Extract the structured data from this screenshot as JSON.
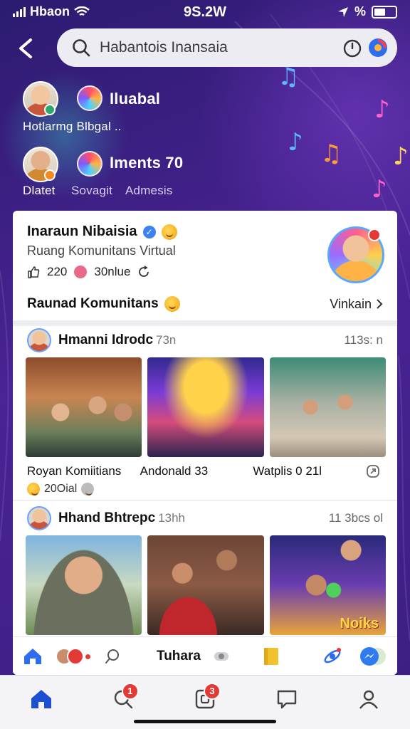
{
  "status_bar": {
    "carrier": "Hbaon",
    "time": "9S.2W",
    "battery_text": "%"
  },
  "search": {
    "value": "Habantois Inansaia"
  },
  "people": [
    {
      "label": "Iluabal"
    },
    {
      "label": "Hotlarmg Blbgal .."
    },
    {
      "label": "Iments 70"
    },
    {
      "label": "Dlatet"
    },
    {
      "label": "Sovagit"
    },
    {
      "label": "Admesis"
    }
  ],
  "group": {
    "title": "Inaraun Nibaisia",
    "subtitle": "Ruang Komunitans Virtual",
    "likes": "220",
    "members": "30nlue",
    "community_label": "Raunad Komunitans",
    "see_all": "Vinkain"
  },
  "posts": [
    {
      "author": "Hmanni Idrodc",
      "meta": "73n",
      "time": "113s: n",
      "captions": [
        "Royan Komiitians",
        "Andonald 33",
        "Watplis 0 21l"
      ],
      "reactions": "20Oial"
    },
    {
      "author": "Hhand Bhtrepc",
      "meta": "13hh",
      "time": "11 3bcs ol",
      "photo_tag": "Noiks"
    }
  ],
  "card_bar": {
    "label": "Tuhara"
  },
  "bottom_nav": {
    "search_badge": "1",
    "groups_badge": "3"
  },
  "colors": {
    "accent": "#1f4fd1",
    "badge": "#e53935",
    "background": "#3b1e82"
  }
}
